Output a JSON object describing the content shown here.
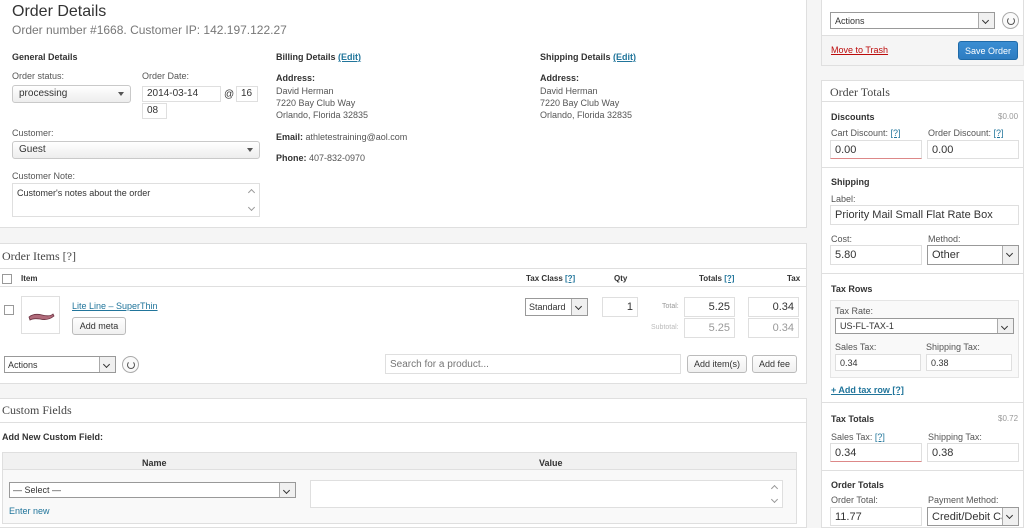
{
  "order": {
    "title": "Order Details",
    "subtitle": "Order number #1668. Customer IP: 142.197.122.27"
  },
  "general": {
    "heading": "General Details",
    "status_label": "Order status:",
    "status_value": "processing",
    "date_label": "Order Date:",
    "date_value": "2014-03-14",
    "at": "@",
    "hour": "16",
    "minute": "08",
    "customer_label": "Customer:",
    "customer_value": "Guest",
    "note_label": "Customer Note:",
    "note_value": "Customer's notes about the order"
  },
  "billing": {
    "heading": "Billing Details",
    "edit": "(Edit)",
    "address_label": "Address:",
    "name": "David Herman",
    "street": "7220 Bay Club Way",
    "city": "Orlando, Florida 32835",
    "email_label": "Email:",
    "email": "athletestraining@aol.com",
    "phone_label": "Phone:",
    "phone": "407-832-0970"
  },
  "shipping_details": {
    "heading": "Shipping Details",
    "edit": "(Edit)",
    "address_label": "Address:",
    "name": "David Herman",
    "street": "7220 Bay Club Way",
    "city": "Orlando, Florida 32835"
  },
  "items": {
    "title": "Order Items [?]",
    "col_item": "Item",
    "col_tax_class": "Tax Class",
    "help": "[?]",
    "col_qty": "Qty",
    "col_totals": "Totals",
    "col_tax": "Tax",
    "product_name": "Lite Line – SuperThin",
    "add_meta": "Add meta",
    "tax_class_value": "Standard",
    "qty": "1",
    "total_label": "Total:",
    "total": "5.25",
    "total_tax": "0.34",
    "subtotal_label": "Subtotal:",
    "subtotal": "5.25",
    "subtotal_tax": "0.34",
    "actions": "Actions",
    "search_placeholder": "Search for a product...",
    "add_items": "Add item(s)",
    "add_fee": "Add fee"
  },
  "custom_fields": {
    "title": "Custom Fields",
    "add_new": "Add New Custom Field:",
    "col_name": "Name",
    "col_value": "Value",
    "select": "— Select —",
    "enter_new": "Enter new"
  },
  "sidebar": {
    "actions": "Actions",
    "trash": "Move to Trash",
    "save": "Save Order",
    "totals_title": "Order Totals",
    "discounts": "Discounts",
    "discounts_amount": "$0.00",
    "cart_discount_label": "Cart Discount:",
    "order_discount_label": "Order Discount:",
    "help": "[?]",
    "cart_discount": "0.00",
    "order_discount": "0.00",
    "shipping": "Shipping",
    "label_label": "Label:",
    "label_value": "Priority Mail Small Flat Rate Box",
    "cost_label": "Cost:",
    "cost": "5.80",
    "method_label": "Method:",
    "method": "Other",
    "tax_rows": "Tax Rows",
    "tax_rate_label": "Tax Rate:",
    "tax_rate": "US-FL-TAX-1",
    "sales_tax_label": "Sales Tax:",
    "shipping_tax_label": "Shipping Tax:",
    "row_sales_tax": "0.34",
    "row_shipping_tax": "0.38",
    "add_tax_row": "+ Add tax row [?]",
    "tax_totals": "Tax Totals",
    "tax_totals_amount": "$0.72",
    "sales_tax": "0.34",
    "shipping_tax": "0.38",
    "order_totals": "Order Totals",
    "order_total_label": "Order Total:",
    "payment_method_label": "Payment Method:",
    "order_total": "11.77",
    "payment_method": "Credit/Debit Ca"
  },
  "colors": {
    "primary": "#2e7dc1",
    "link": "#21759b",
    "trash": "#bc0b0b"
  }
}
